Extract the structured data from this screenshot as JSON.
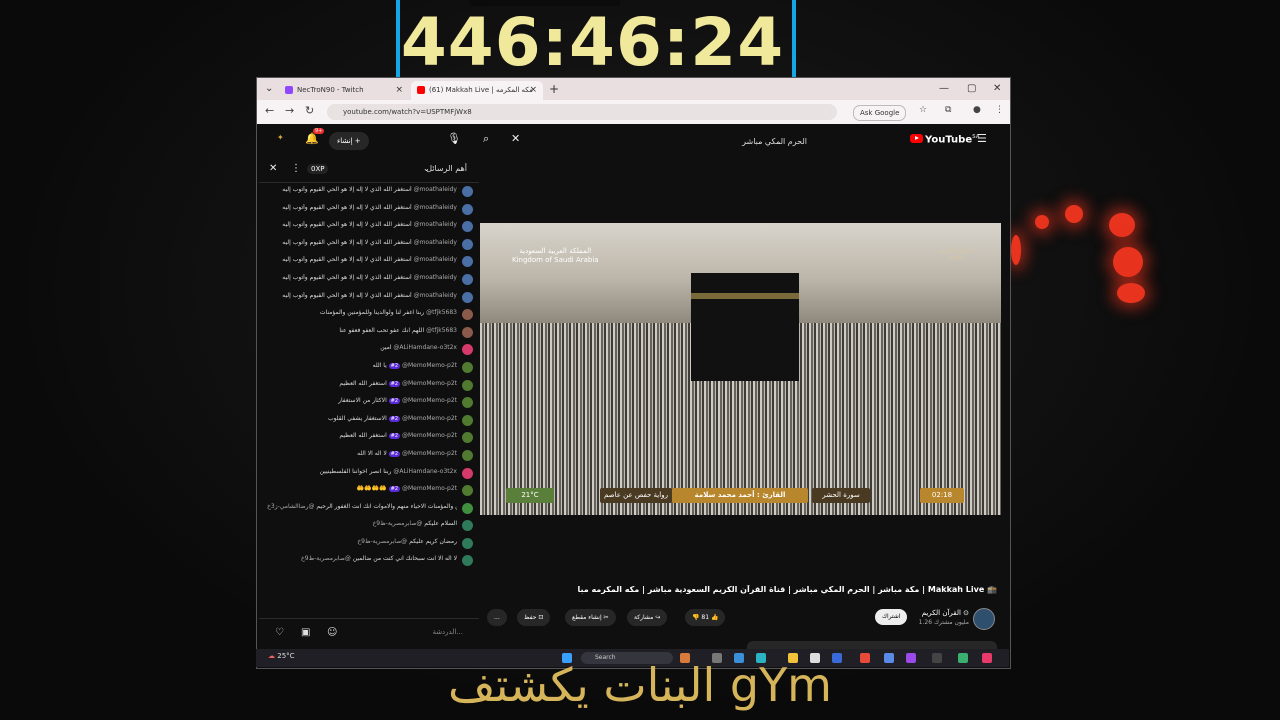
{
  "timer": "446:46:24",
  "overlay_text": "البنات يكشتف gYm",
  "browser": {
    "tabs": [
      {
        "label": "NecTroN90 - Twitch",
        "active": false
      },
      {
        "label": "(61) Makkah Live | مكه المكرمه مبا",
        "active": true
      }
    ],
    "new_tab": "+",
    "window_controls": [
      "—",
      "▢",
      "✕"
    ],
    "url": "youtube.com/watch?v=USPTMFjWx8",
    "ask_google": "Ask Google"
  },
  "youtube": {
    "search_query": "الحرم المكي مباشر",
    "logo_text": "YouTube",
    "logo_region": "SA",
    "create_label": "إنشاء",
    "notification_count": "9+"
  },
  "chat": {
    "header_label": "أهم الرسائل",
    "xp_badge": "0XP",
    "input_placeholder": "الدردشة...",
    "messages": [
      {
        "user": "@moathaleidy",
        "text": "أستغفر الله الذي لا إله إلا هو الحي القيوم وأتوب إليه",
        "color": "#4a6fa5"
      },
      {
        "user": "@moathaleidy",
        "text": "أستغفر الله الذي لا إله إلا هو الحي القيوم وأتوب إليه",
        "color": "#4a6fa5"
      },
      {
        "user": "@moathaleidy",
        "text": "أستغفر الله الذي لا إله إلا هو الحي القيوم وأتوب إليه",
        "color": "#4a6fa5"
      },
      {
        "user": "@moathaleidy",
        "text": "أستغفر الله الذي لا إله إلا هو الحي القيوم وأتوب إليه",
        "color": "#4a6fa5"
      },
      {
        "user": "@moathaleidy",
        "text": "أستغفر الله الذي لا إله إلا هو الحي القيوم وأتوب إليه",
        "color": "#4a6fa5"
      },
      {
        "user": "@moathaleidy",
        "text": "أستغفر الله الذي لا إله إلا هو الحي القيوم وأتوب إليه",
        "color": "#4a6fa5"
      },
      {
        "user": "@moathaleidy",
        "text": "أستغفر الله الذي لا إله إلا هو الحي القيوم وأتوب إليه",
        "color": "#4a6fa5"
      },
      {
        "user": "@tfjk5683",
        "text": "ربنا اغفر لنا ولوالدينا وللمؤمنين والمؤمنات",
        "color": "#8a5a4a"
      },
      {
        "user": "@tfjk5683",
        "text": "اللهم انك عفو تحب العفو فعفو عنا",
        "color": "#8a5a4a"
      },
      {
        "user": "@ALiHamdane-o3t2x",
        "text": "امين",
        "color": "#d63a6a"
      },
      {
        "user": "@MemoMemo-p2t",
        "badge": "#2",
        "text": "يا الله",
        "color": "#4f7a2f"
      },
      {
        "user": "@MemoMemo-p2t",
        "badge": "#2",
        "text": "استغفر الله العظيم",
        "color": "#4f7a2f"
      },
      {
        "user": "@MemoMemo-p2t",
        "badge": "#2",
        "text": "الاكثار من الاستغفار",
        "color": "#4f7a2f"
      },
      {
        "user": "@MemoMemo-p2t",
        "badge": "#2",
        "text": "الاستغفار يشفي القلوب",
        "color": "#4f7a2f"
      },
      {
        "user": "@MemoMemo-p2t",
        "badge": "#2",
        "text": "استغفر الله العظيم",
        "color": "#4f7a2f"
      },
      {
        "user": "@MemoMemo-p2t",
        "badge": "#2",
        "text": "لا اله الا الله",
        "color": "#4f7a2f"
      },
      {
        "user": "@ALiHamdane-o3t2x",
        "text": "ربنا انصر اخواننا الفلسطينيين",
        "color": "#d63a6a"
      },
      {
        "user": "@MemoMemo-p2t",
        "badge": "#2",
        "text": "🤲🤲🤲🤲",
        "color": "#4f7a2f"
      },
      {
        "user": "@رضاالشامي-ز3خ",
        "text": "ربي اغفر لي ولوالدي والمؤمنين والمؤمنات الاحياء منهم والاموات انك انت الغفور الرحيم",
        "color": "#3f8f3f"
      },
      {
        "user": "@صابرمصرية-ظ9خ",
        "text": "السلام عليكم",
        "color": "#2f7a5a"
      },
      {
        "user": "@صابرمصرية-ظ9خ",
        "text": "رمضان كريم عليكم",
        "color": "#2f7a5a"
      },
      {
        "user": "@صابرمصرية-ظ9خ",
        "text": "لا اله الا انت سبحانك اني كنت من ضالمين",
        "color": "#2f7a5a"
      }
    ]
  },
  "video": {
    "overlay_kingdom": "المملكة العربية السعودية\nKingdom of Saudi Arabia",
    "overlay_live": "القرآن الكريم\nLive",
    "reciter": "القارئ : أحمد محمد سلامة",
    "surah": "سورة الحشر",
    "riwaya": "رواية حفص عن عاصم",
    "temperature_badge": "21°C",
    "time": "02:18"
  },
  "video_info": {
    "title": "مكة مباشر | الحرم المكي مباشر | قناة القرآن الكريم السعودية مباشر | مكه المكرمه مبا | Makkah Live 🕋",
    "channel_name": "القرآن الكريم ⊙",
    "subscribers": "1.26 مليون مشترك",
    "subscribe_label": "اشتراك",
    "likes": "81",
    "share_label": "مشاركة",
    "clip_label": "إنشاء مقطع",
    "save_label": "حفظ",
    "more_label": "..."
  },
  "taskbar": {
    "weather": "25°C",
    "search_label": "Search"
  }
}
